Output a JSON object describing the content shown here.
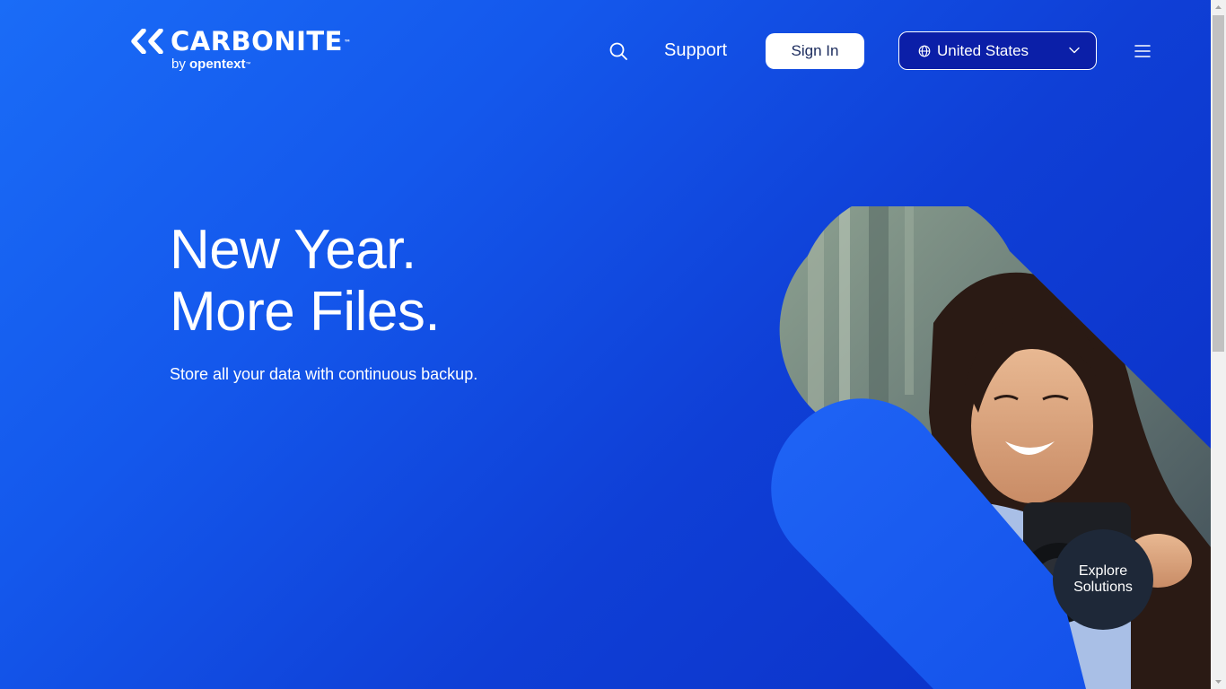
{
  "header": {
    "logo": {
      "wordmark": "CARBONITE",
      "trademark": "™",
      "by": "by",
      "parent_brand": "opentext",
      "parent_trademark": "™"
    },
    "search_icon": "search-icon",
    "support_label": "Support",
    "signin_label": "Sign In",
    "region": {
      "selected": "United States",
      "icon": "globe-icon",
      "chevron": "chevron-down-icon"
    },
    "menu_icon": "hamburger-menu-icon"
  },
  "hero": {
    "title_line1": "New Year.",
    "title_line2": "More Files.",
    "subtitle": "Store all your data with continuous backup.",
    "cta_line1": "Explore",
    "cta_line2": "Solutions"
  },
  "colors": {
    "background_start": "#1a6cf7",
    "background_end": "#0b2ec4",
    "accent_blue": "#1f64f5",
    "signin_text": "#1a2a5c",
    "region_bg": "#0b1fa8",
    "cta_bg": "#1e2838",
    "scrollbar_track": "#f1f1f1",
    "scrollbar_thumb": "#c1c1c1"
  }
}
